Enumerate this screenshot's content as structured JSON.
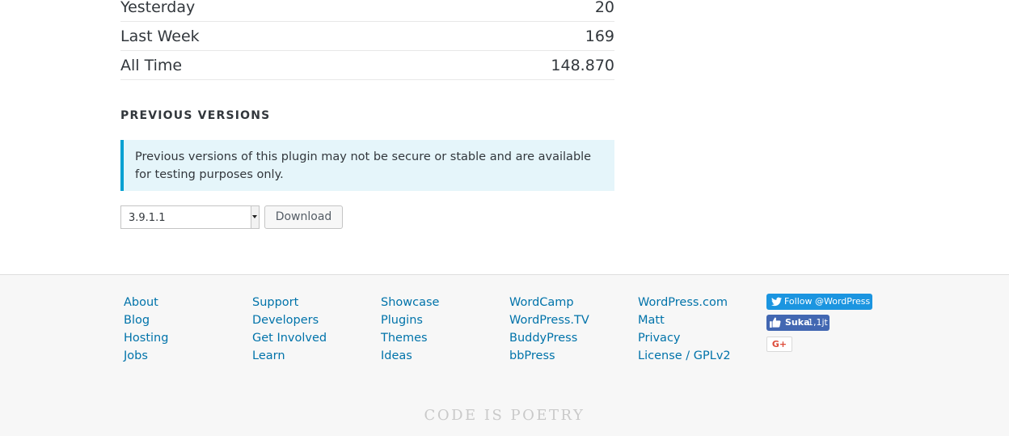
{
  "stats": [
    {
      "label": "Yesterday",
      "value": "20"
    },
    {
      "label": "Last Week",
      "value": "169"
    },
    {
      "label": "All Time",
      "value": "148.870"
    }
  ],
  "previous_versions": {
    "title": "PREVIOUS VERSIONS",
    "notice": "Previous versions of this plugin may not be secure or stable and are available for testing purposes only.",
    "selected_version": "3.9.1.1",
    "download_label": "Download"
  },
  "footer": {
    "columns": [
      [
        "About",
        "Blog",
        "Hosting",
        "Jobs"
      ],
      [
        "Support",
        "Developers",
        "Get Involved",
        "Learn"
      ],
      [
        "Showcase",
        "Plugins",
        "Themes",
        "Ideas"
      ],
      [
        "WordCamp",
        "WordPress.TV",
        "BuddyPress",
        "bbPress"
      ],
      [
        "WordPress.com",
        "Matt",
        "Privacy",
        "License / GPLv2"
      ]
    ],
    "twitter_label": "Follow @WordPress",
    "facebook_like_label": "Suka",
    "facebook_like_count": "1,1jt",
    "gplus_label": "G+",
    "tagline": "CODE IS POETRY"
  },
  "colors": {
    "link": "#0073aa",
    "notice_bg": "#e5f5fa",
    "notice_border": "#00a0d2",
    "twitter": "#1b95e0",
    "facebook": "#4267b2",
    "gplus": "#dd4b39"
  },
  "icons": [
    "twitter-bird-icon",
    "facebook-thumb-icon",
    "chevron-down-icon"
  ]
}
